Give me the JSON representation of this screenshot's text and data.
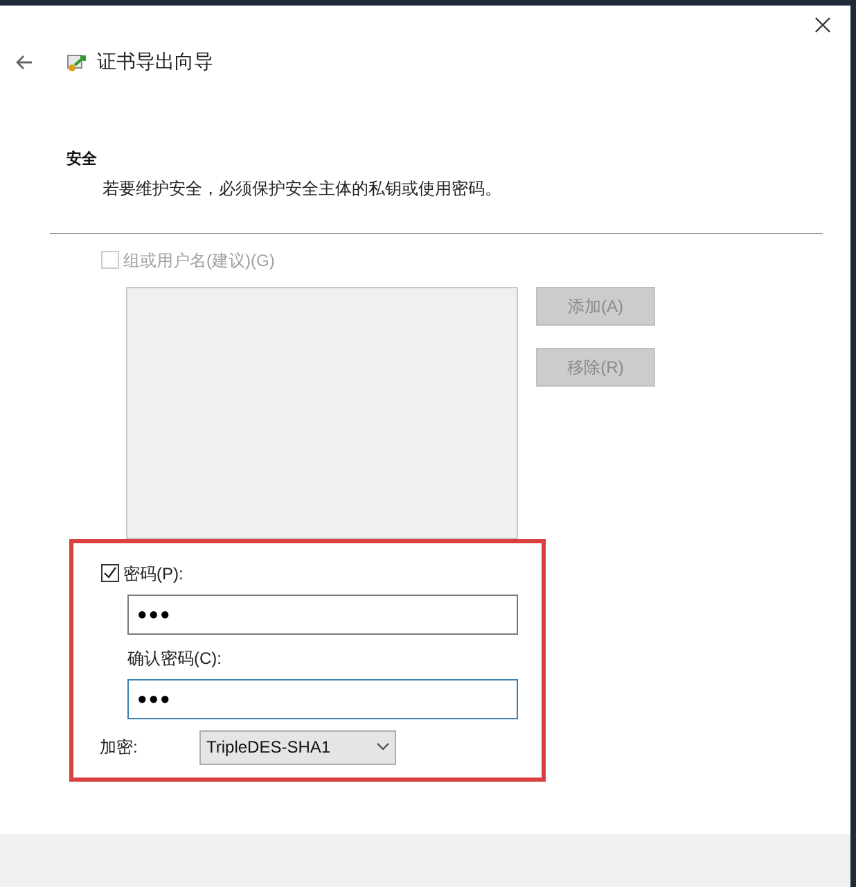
{
  "window": {
    "title": "证书导出向导"
  },
  "section": {
    "heading": "安全",
    "description": "若要维护安全，必须保护安全主体的私钥或使用密码。"
  },
  "group_option": {
    "label": "组或用户名(建议)(G)",
    "checked": false,
    "disabled": true
  },
  "group_buttons": [
    {
      "label": "添加(A)",
      "disabled": true
    },
    {
      "label": "移除(R)",
      "disabled": true
    }
  ],
  "password_option": {
    "label": "密码(P):",
    "checked": true,
    "disabled": false
  },
  "password": {
    "value": "●●●",
    "focused": false
  },
  "confirm": {
    "label": "确认密码(C):",
    "value": "●●●",
    "focused": true
  },
  "encryption": {
    "label": "加密:",
    "value": "TripleDES-SHA1"
  }
}
